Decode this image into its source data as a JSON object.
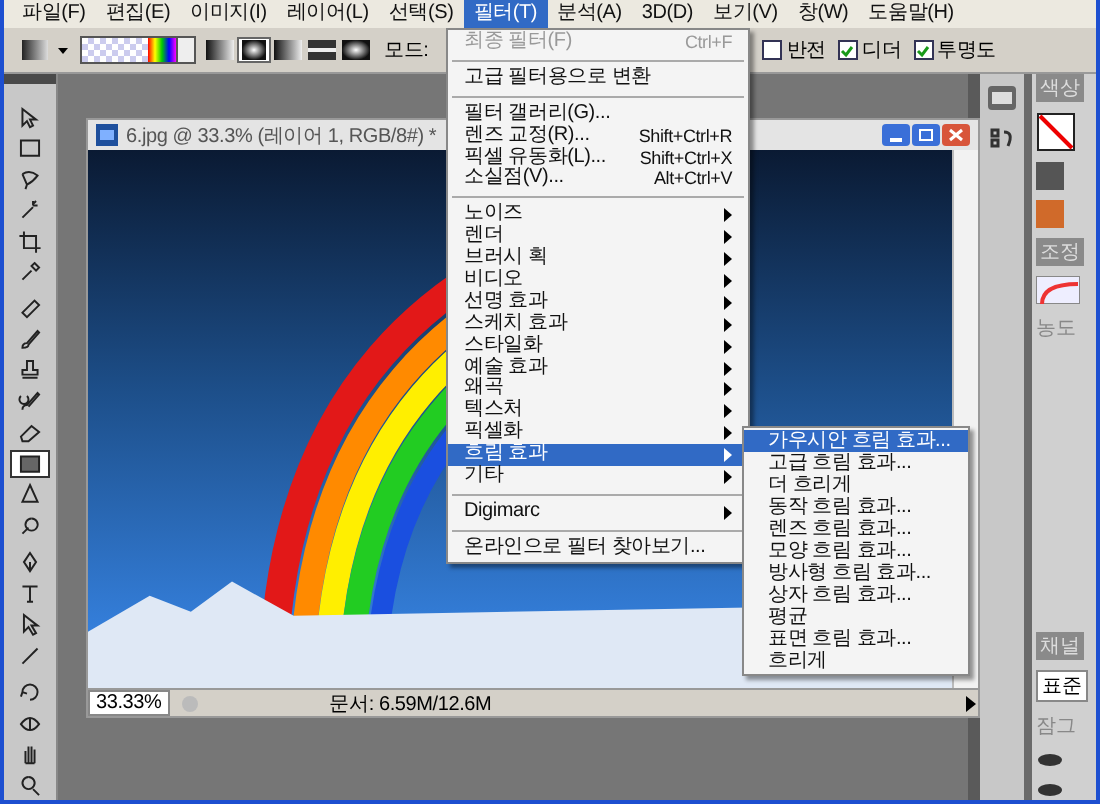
{
  "menu_bar": [
    {
      "label": "파일(F)",
      "selected": false
    },
    {
      "label": "편집(E)",
      "selected": false
    },
    {
      "label": "이미지(I)",
      "selected": false
    },
    {
      "label": "레이어(L)",
      "selected": false
    },
    {
      "label": "선택(S)",
      "selected": false
    },
    {
      "label": "필터(T)",
      "selected": true
    },
    {
      "label": "분석(A)",
      "selected": false
    },
    {
      "label": "3D(D)",
      "selected": false
    },
    {
      "label": "보기(V)",
      "selected": false
    },
    {
      "label": "창(W)",
      "selected": false
    },
    {
      "label": "도움말(H)",
      "selected": false
    }
  ],
  "options_bar": {
    "mode_label": "모드:",
    "checkboxes": [
      {
        "label": "반전",
        "checked": false
      },
      {
        "label": "디더",
        "checked": true
      },
      {
        "label": "투명도",
        "checked": true
      }
    ]
  },
  "tools": [
    {
      "selected": false
    },
    {
      "selected": false
    },
    {
      "selected": false
    },
    {
      "selected": false
    },
    {
      "selected": false
    },
    {
      "selected": false
    },
    {
      "selected": false
    },
    {
      "selected": false
    },
    {
      "selected": false
    },
    {
      "selected": false
    },
    {
      "selected": false
    },
    {
      "selected": true
    },
    {
      "selected": false
    },
    {
      "selected": false
    },
    {
      "selected": false
    },
    {
      "selected": false
    },
    {
      "selected": false
    },
    {
      "selected": false
    },
    {
      "selected": false
    },
    {
      "selected": false
    },
    {
      "selected": false
    },
    {
      "selected": false
    }
  ],
  "document": {
    "title": "6.jpg @ 33.3% (레이어 1, RGB/8#) *",
    "zoom": "33.33%",
    "doc_info": "문서: 6.59M/12.6M"
  },
  "filter_menu": {
    "items": [
      {
        "kind": "item",
        "label": "최종 필터(F)",
        "shortcut": "Ctrl+F",
        "disabled": true,
        "selected": false
      },
      {
        "kind": "separator"
      },
      {
        "kind": "item",
        "label": "고급 필터용으로 변환",
        "disabled": false,
        "selected": false
      },
      {
        "kind": "separator"
      },
      {
        "kind": "item",
        "label": "필터 갤러리(G)...",
        "disabled": false,
        "selected": false
      },
      {
        "kind": "item",
        "label": "렌즈 교정(R)...",
        "shortcut": "Shift+Ctrl+R",
        "disabled": false,
        "selected": false
      },
      {
        "kind": "item",
        "label": "픽셀 유동화(L)...",
        "shortcut": "Shift+Ctrl+X",
        "disabled": false,
        "selected": false
      },
      {
        "kind": "item",
        "label": "소실점(V)...",
        "shortcut": "Alt+Ctrl+V",
        "disabled": false,
        "selected": false
      },
      {
        "kind": "separator"
      },
      {
        "kind": "submenu",
        "label": "노이즈",
        "disabled": false,
        "selected": false
      },
      {
        "kind": "submenu",
        "label": "렌더",
        "disabled": false,
        "selected": false
      },
      {
        "kind": "submenu",
        "label": "브러시 획",
        "disabled": false,
        "selected": false
      },
      {
        "kind": "submenu",
        "label": "비디오",
        "disabled": false,
        "selected": false
      },
      {
        "kind": "submenu",
        "label": "선명 효과",
        "disabled": false,
        "selected": false
      },
      {
        "kind": "submenu",
        "label": "스케치 효과",
        "disabled": false,
        "selected": false
      },
      {
        "kind": "submenu",
        "label": "스타일화",
        "disabled": false,
        "selected": false
      },
      {
        "kind": "submenu",
        "label": "예술 효과",
        "disabled": false,
        "selected": false
      },
      {
        "kind": "submenu",
        "label": "왜곡",
        "disabled": false,
        "selected": false
      },
      {
        "kind": "submenu",
        "label": "텍스처",
        "disabled": false,
        "selected": false
      },
      {
        "kind": "submenu",
        "label": "픽셀화",
        "disabled": false,
        "selected": false
      },
      {
        "kind": "submenu",
        "label": "흐림 효과",
        "disabled": false,
        "selected": true
      },
      {
        "kind": "submenu",
        "label": "기타",
        "disabled": false,
        "selected": false
      },
      {
        "kind": "separator"
      },
      {
        "kind": "submenu",
        "label": "Digimarc",
        "disabled": false,
        "selected": false
      },
      {
        "kind": "separator"
      },
      {
        "kind": "item",
        "label": "온라인으로 필터 찾아보기...",
        "disabled": false,
        "selected": false
      }
    ]
  },
  "blur_submenu": {
    "items": [
      {
        "label": "가우시안 흐림 효과...",
        "selected": true
      },
      {
        "label": "고급 흐림 효과...",
        "selected": false
      },
      {
        "label": "더 흐리게",
        "selected": false
      },
      {
        "label": "동작 흐림 효과...",
        "selected": false
      },
      {
        "label": "렌즈 흐림 효과...",
        "selected": false
      },
      {
        "label": "모양 흐림 효과...",
        "selected": false
      },
      {
        "label": "방사형 흐림 효과...",
        "selected": false
      },
      {
        "label": "상자 흐림 효과...",
        "selected": false
      },
      {
        "label": "평균",
        "selected": false
      },
      {
        "label": "표면 흐림 효과...",
        "selected": false
      },
      {
        "label": "흐리게",
        "selected": false
      }
    ]
  },
  "right_panel": {
    "color_tab": "색상",
    "adjust_tab": "조정",
    "density_label": "농도",
    "channel_tab": "채널",
    "blend_mode": "표준",
    "lock_label": "잠그"
  }
}
